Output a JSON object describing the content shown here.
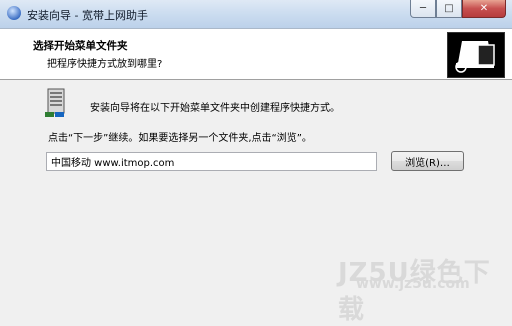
{
  "window": {
    "title": "安装向导 - 宽带上网助手",
    "controls": {
      "minimize": "─",
      "maximize": "□",
      "close": "✕"
    }
  },
  "header": {
    "title": "选择开始菜单文件夹",
    "subtitle": "把程序快捷方式放到哪里?"
  },
  "body": {
    "description": "安装向导将在以下开始菜单文件夹中创建程序快捷方式。",
    "instruction": "点击“下一步”继续。如果要选择另一个文件夹,点击“浏览”。",
    "folder_value": "中国移动 www.itmop.com",
    "browse_label": "浏览(R)…"
  },
  "watermark": {
    "text": "JZ5U绿色下载",
    "url": "www.jz5u.com"
  }
}
